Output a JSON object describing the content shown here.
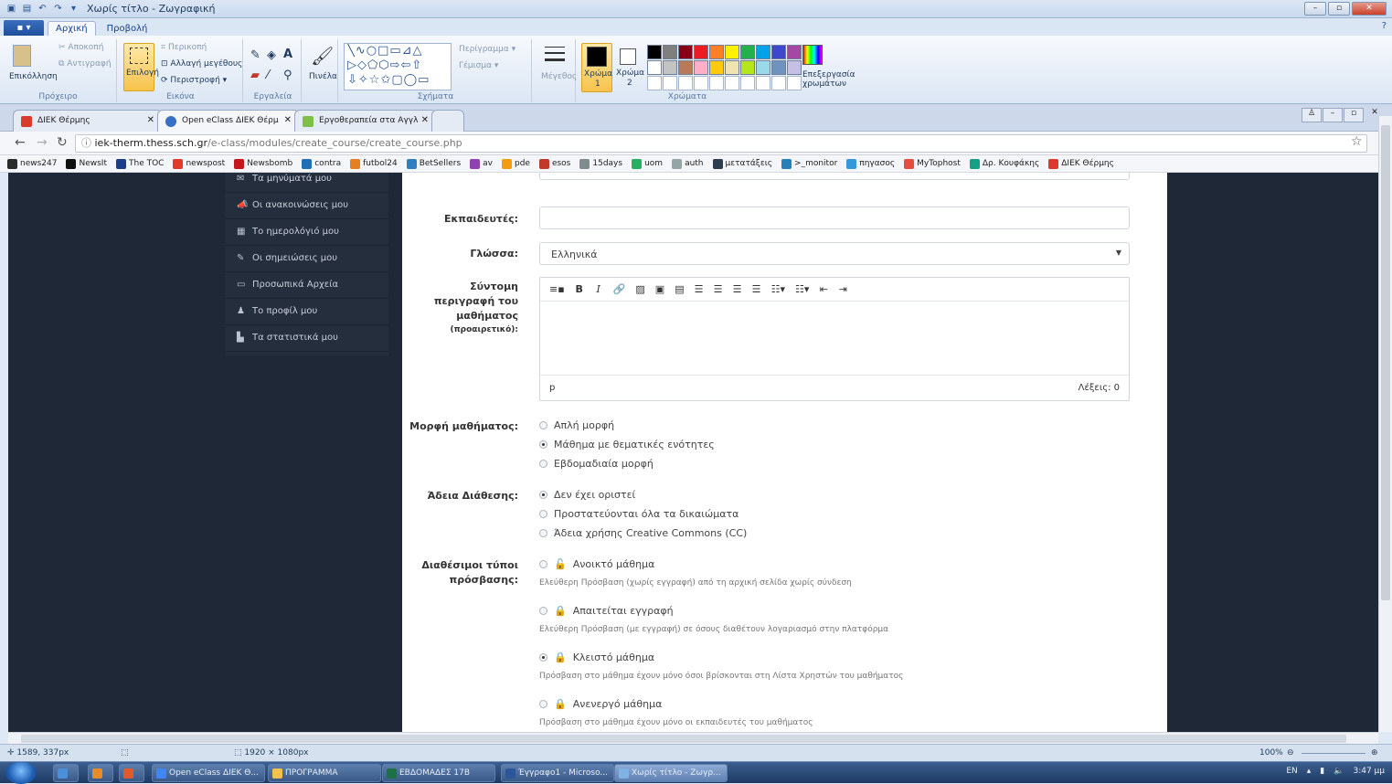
{
  "paint": {
    "title": "Χωρίς τίτλο - Ζωγραφική",
    "file_tab": "▪ ▾",
    "tabs": [
      "Αρχική",
      "Προβολή"
    ],
    "clipboard": {
      "paste": "Επικόλληση",
      "cut": "Αποκοπή",
      "copy": "Αντιγραφή",
      "group": "Πρόχειρο"
    },
    "image": {
      "select": "Επιλογή",
      "crop": "Περικοπή",
      "resize": "Αλλαγή μεγέθους",
      "rotate": "Περιστροφή ▾",
      "group": "Εικόνα"
    },
    "tools": {
      "group": "Εργαλεία",
      "brushes": "Πινέλα"
    },
    "shapes": {
      "outline": "Περίγραμμα ▾",
      "fill": "Γέμισμα ▾",
      "group": "Σχήματα"
    },
    "size": "Μέγεθος",
    "color1": "Χρώμα\n1",
    "color1_label": "Χρώμα",
    "color1_num": "1",
    "color2_label": "Χρώμα",
    "color2_num": "2",
    "colors_group": "Χρώματα",
    "edit_colors": "Επεξεργασία χρωμάτων",
    "palette": [
      "#000000",
      "#7f7f7f",
      "#880015",
      "#ed1c24",
      "#ff7f27",
      "#fff200",
      "#22b14c",
      "#00a2e8",
      "#3f48cc",
      "#a349a4",
      "#ffffff",
      "#c3c3c3",
      "#b97a57",
      "#ffaec9",
      "#ffc90e",
      "#efe4b0",
      "#b5e61d",
      "#99d9ea",
      "#7092be",
      "#c8bfe7"
    ],
    "status": {
      "cursor": "1589, 337px",
      "dimensions": "1920 × 1080px",
      "zoom": "100%"
    }
  },
  "browser": {
    "tabs": [
      {
        "label": "ΔΙΕΚ Θέρμης",
        "color": "#d93a2b"
      },
      {
        "label": "Open eClass ΔΙΕΚ Θέρμ",
        "color": "#3a6fc6"
      },
      {
        "label": "Εργοθεραπεία στα Αγγλ",
        "color": "#7cc04a"
      }
    ],
    "url_host": "iek-therm.thess.sch.gr",
    "url_path": "/e-class/modules/create_course/create_course.php",
    "bookmarks": [
      {
        "label": "news247",
        "color": "#2b2b2b"
      },
      {
        "label": "NewsIt",
        "color": "#111111"
      },
      {
        "label": "The TOC",
        "color": "#1b3e8a"
      },
      {
        "label": "newspost",
        "color": "#e23a2b"
      },
      {
        "label": "Newsbomb",
        "color": "#c4161c"
      },
      {
        "label": "contra",
        "color": "#1f6fb5"
      },
      {
        "label": "futbol24",
        "color": "#e67e22"
      },
      {
        "label": "BetSellers",
        "color": "#2f80c1"
      },
      {
        "label": "av",
        "color": "#8e44ad"
      },
      {
        "label": "pde",
        "color": "#f39c12"
      },
      {
        "label": "esos",
        "color": "#c0392b"
      },
      {
        "label": "15days",
        "color": "#7f8c8d"
      },
      {
        "label": "uom",
        "color": "#27ae60"
      },
      {
        "label": "auth",
        "color": "#95a5a6"
      },
      {
        "label": "μετατάξεις",
        "color": "#2c3e50"
      },
      {
        "label": ">_monitor",
        "color": "#2980b9"
      },
      {
        "label": "πηγασος",
        "color": "#3498db"
      },
      {
        "label": "MyTophost",
        "color": "#e74c3c"
      },
      {
        "label": "Δρ. Κουφάκης",
        "color": "#16a085"
      },
      {
        "label": "ΔΙΕΚ Θέρμης",
        "color": "#d93a2b"
      }
    ]
  },
  "sidebar": {
    "items": [
      {
        "icon": "✉",
        "label": "Τα μηνύματά μου"
      },
      {
        "icon": "📣",
        "label": "Οι ανακοινώσεις μου"
      },
      {
        "icon": "▦",
        "label": "Το ημερολόγιό μου"
      },
      {
        "icon": "✎",
        "label": "Οι σημειώσεις μου"
      },
      {
        "icon": "▭",
        "label": "Προσωπικά Αρχεία"
      },
      {
        "icon": "♟",
        "label": "Το προφίλ μου"
      },
      {
        "icon": "▙",
        "label": "Τα στατιστικά μου"
      }
    ]
  },
  "form": {
    "instructors_label": "Εκπαιδευτές:",
    "instructors_value": "",
    "language_label": "Γλώσσα:",
    "language_value": "Ελληνικά",
    "desc_label_1": "Σύντομη",
    "desc_label_2": "περιγραφή του",
    "desc_label_3": "μαθήματος",
    "desc_label_4": "(προαιρετικό):",
    "editor_path": "p",
    "editor_words": "Λέξεις: 0",
    "format_label": "Μορφή μαθήματος:",
    "format_options": [
      {
        "label": "Απλή μορφή",
        "checked": false
      },
      {
        "label": "Μάθημα με θεματικές ενότητες",
        "checked": true
      },
      {
        "label": "Εβδομαδιαία μορφή",
        "checked": false
      }
    ],
    "license_label": "Άδεια Διάθεσης:",
    "license_options": [
      {
        "label": "Δεν έχει οριστεί",
        "checked": true
      },
      {
        "label": "Προστατεύονται όλα τα δικαιώματα",
        "checked": false
      },
      {
        "label": "Άδεια χρήσης Creative Commons (CC)",
        "checked": false
      }
    ],
    "access_label_1": "Διαθέσιμοι τύποι",
    "access_label_2": "πρόσβασης:",
    "access_options": [
      {
        "label": "Ανοικτό μάθημα",
        "desc": "Ελεύθερη Πρόσβαση (χωρίς εγγραφή) από τη αρχική σελίδα χωρίς σύνδεση",
        "checked": false
      },
      {
        "label": "Απαιτείται εγγραφή",
        "desc": "Ελεύθερη Πρόσβαση (με εγγραφή) σε όσους διαθέτουν λογαριασμό στην πλατφόρμα",
        "checked": false
      },
      {
        "label": "Κλειστό μάθημα",
        "desc": "Πρόσβαση στο μάθημα έχουν μόνο όσοι βρίσκονται στη Λίστα Χρηστών του μαθήματος",
        "checked": true
      },
      {
        "label": "Ανενεργό μάθημα",
        "desc": "Πρόσβαση στο μάθημα έχουν μόνο οι εκπαιδευτές του μαθήματος",
        "checked": false
      }
    ]
  },
  "taskbar": {
    "items": [
      {
        "label": "",
        "color": "#4a90d9"
      },
      {
        "label": "",
        "color": "#e88b2a"
      },
      {
        "label": "",
        "color": "#e05a2a"
      },
      {
        "label": "Open eClass ΔΙΕΚ Θ...",
        "color": "#4285f4"
      },
      {
        "label": "ΠΡΟΓΡΑΜΜΑ",
        "color": "#f2c14e"
      },
      {
        "label": "ΕΒΔΟΜΑΔΕΣ 17Β",
        "color": "#1e7145"
      },
      {
        "label": "Έγγραφο1 - Microso...",
        "color": "#2b579a"
      },
      {
        "label": "Χωρίς τίτλο - Ζωγρ...",
        "color": "#7fb2e5"
      }
    ],
    "lang": "EN",
    "time": "3:47 μμ"
  }
}
